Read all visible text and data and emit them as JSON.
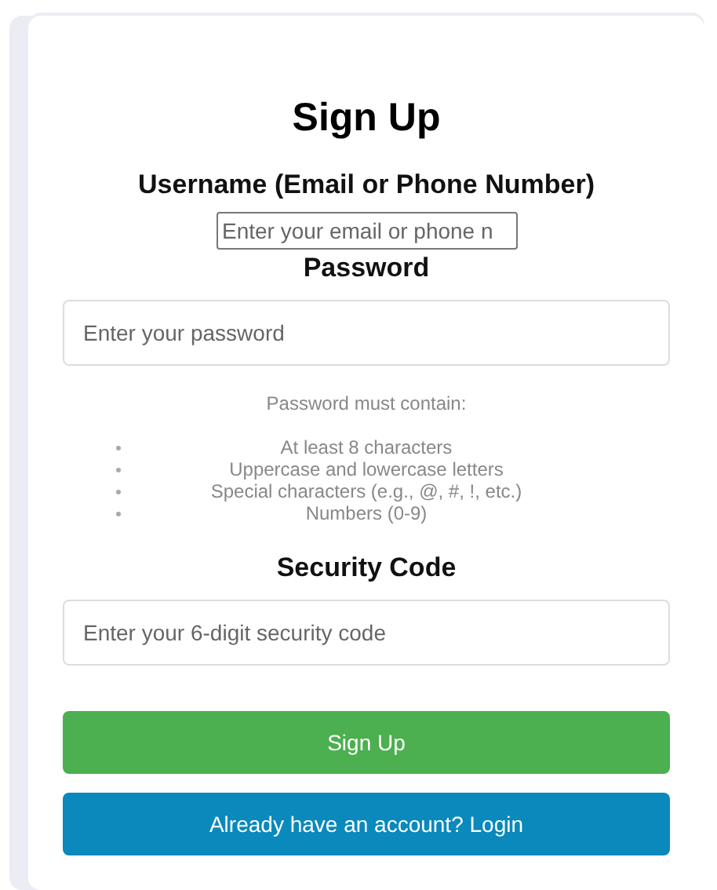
{
  "title": "Sign Up",
  "fields": [
    {
      "label": "Username (Email or Phone Number)",
      "placeholder": "Enter your email or phone n",
      "kind": "compact"
    },
    {
      "label": "Password",
      "placeholder": "Enter your password",
      "kind": "full",
      "requirements": {
        "heading": "Password must contain:",
        "items": [
          "At least 8 characters",
          "Uppercase and lowercase letters",
          "Special characters (e.g., @, #, !, etc.)",
          "Numbers (0-9)"
        ]
      }
    },
    {
      "label": "Security Code",
      "placeholder": "Enter your 6-digit security code",
      "kind": "full"
    }
  ],
  "buttons": [
    {
      "label": "Sign Up",
      "kind": "primary"
    },
    {
      "label": "Already have an account? Login",
      "kind": "secondary"
    }
  ]
}
